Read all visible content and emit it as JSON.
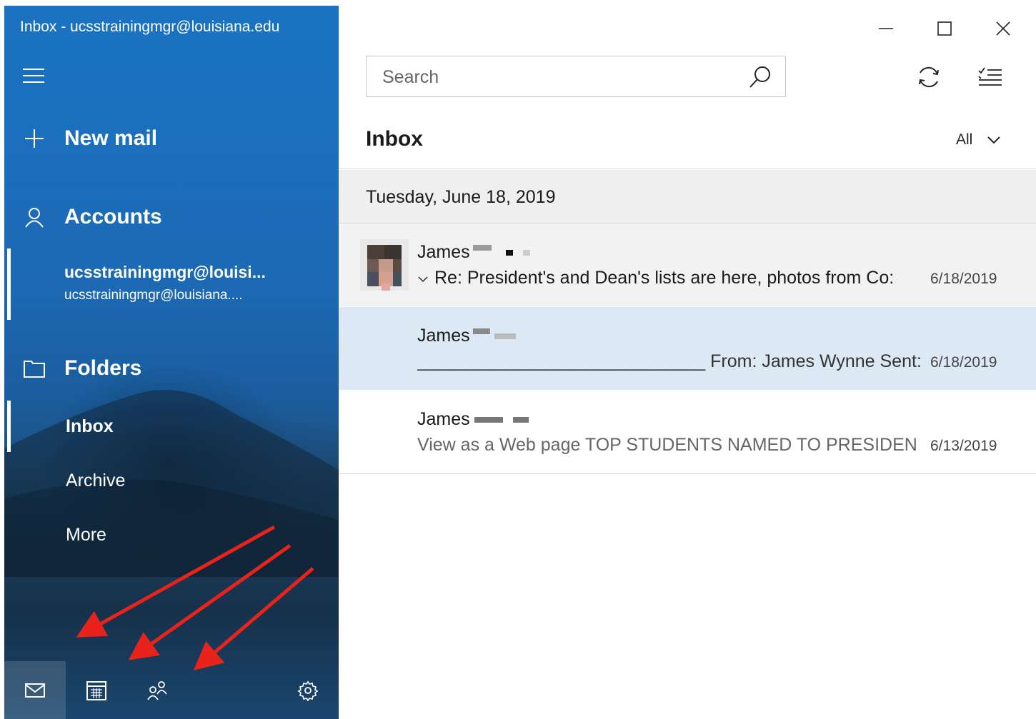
{
  "window": {
    "title": "Inbox - ucsstrainingmgr@louisiana.edu"
  },
  "nav": {
    "new_mail": "New mail",
    "accounts": "Accounts",
    "account_name": "ucsstrainingmgr@louisi...",
    "account_email": "ucsstrainingmgr@louisiana....",
    "folders": "Folders",
    "folder_items": [
      "Inbox",
      "Archive",
      "More"
    ]
  },
  "search": {
    "placeholder": "Search"
  },
  "list": {
    "title": "Inbox",
    "filter": "All",
    "date_group": "Tuesday, June 18, 2019",
    "messages": [
      {
        "sender": "James",
        "preview": "Re: President's and Dean's lists are here, photos from Co:",
        "date": "6/18/2019"
      },
      {
        "sender": "James",
        "preview": "_____________________________ From: James Wynne Sent: Th",
        "date": "6/18/2019"
      },
      {
        "sender": "James",
        "preview": "View as a Web page TOP STUDENTS NAMED TO PRESIDEN",
        "date": "6/13/2019"
      }
    ]
  },
  "colors": {
    "selected_row": "#dce8f4",
    "date_header": "#efefef",
    "annotation_arrow": "#e8231b"
  },
  "icons": [
    "hamburger-icon",
    "plus-icon",
    "person-icon",
    "folder-icon",
    "mail-icon",
    "calendar-icon",
    "people-icon",
    "settings-icon",
    "search-icon",
    "sync-icon",
    "select-icon",
    "minimize-icon",
    "maximize-icon",
    "close-icon",
    "chevron-down-icon"
  ]
}
